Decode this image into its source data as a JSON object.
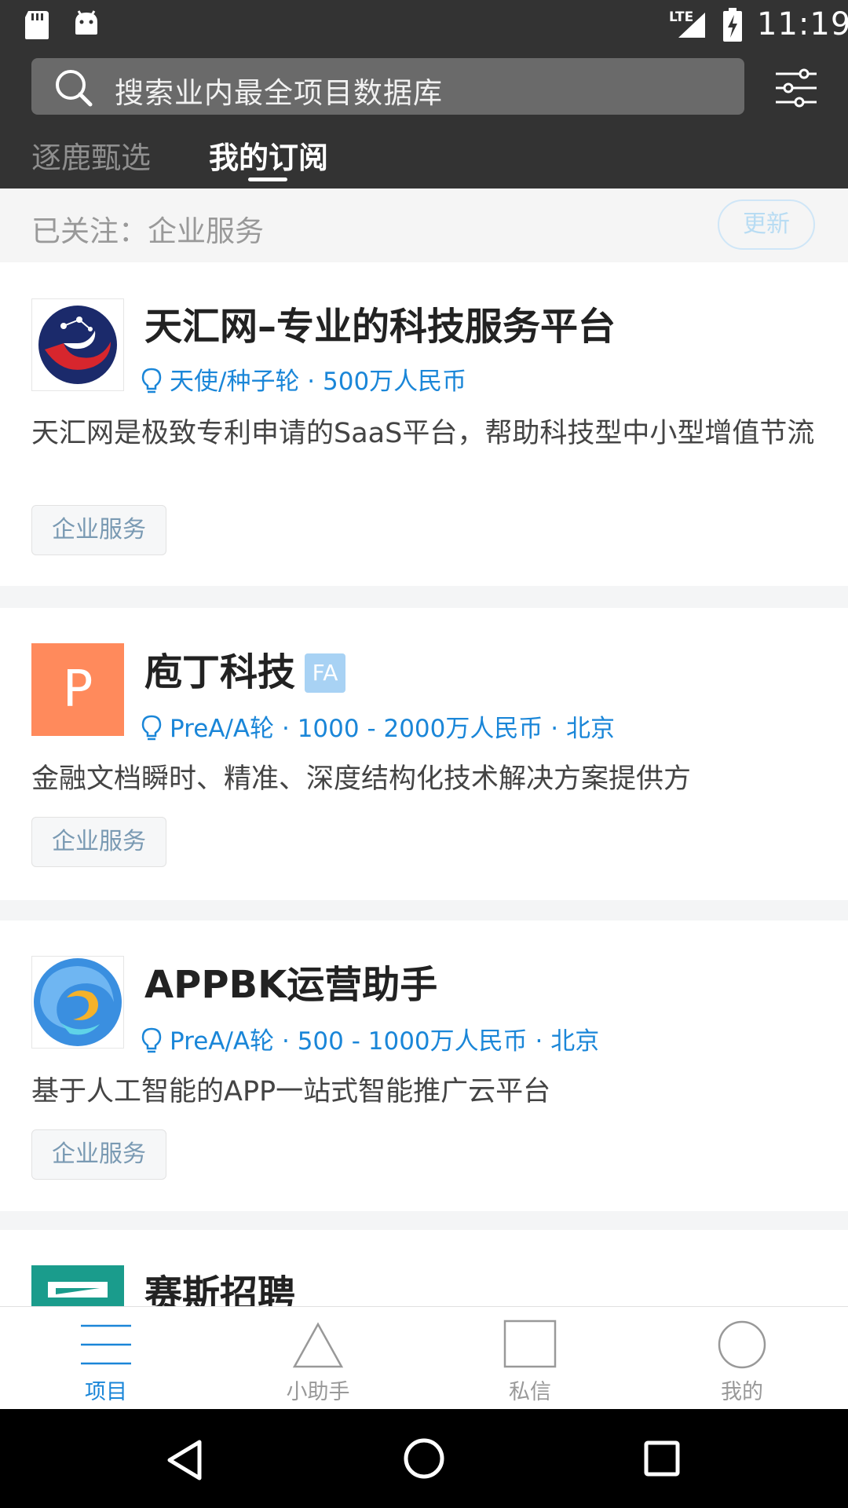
{
  "status_bar": {
    "time": "11:19",
    "network": "LTE"
  },
  "search": {
    "placeholder": "搜索业内最全项目数据库"
  },
  "tabs": [
    {
      "label": "逐鹿甄选",
      "active": false
    },
    {
      "label": "我的订阅",
      "active": true
    }
  ],
  "follow": {
    "label": "已关注：企业服务",
    "refresh_label": "更新"
  },
  "projects": [
    {
      "title": "天汇网–专业的科技服务平台",
      "badge": "",
      "meta": "天使/种子轮 · 500万人民币",
      "description": "天汇网是极致专利申请的SaaS平台，帮助科技型中小型增值节流",
      "tag": "企业服务"
    },
    {
      "title": "庖丁科技",
      "badge": "FA",
      "logo_letter": "P",
      "meta": "PreA/A轮 · 1000 - 2000万人民币 · 北京",
      "description": "金融文档瞬时、精准、深度结构化技术解决方案提供方",
      "tag": "企业服务"
    },
    {
      "title": "APPBK运营助手",
      "badge": "",
      "meta": "PreA/A轮 · 500 - 1000万人民币 · 北京",
      "description": "基于人工智能的APP一站式智能推广云平台",
      "tag": "企业服务"
    },
    {
      "title": "赛斯招聘"
    }
  ],
  "bottom_nav": [
    {
      "label": "项目",
      "icon": "menu-icon",
      "active": true
    },
    {
      "label": "小助手",
      "icon": "triangle-icon",
      "active": false
    },
    {
      "label": "私信",
      "icon": "square-icon",
      "active": false
    },
    {
      "label": "我的",
      "icon": "circle-icon",
      "active": false
    }
  ],
  "colors": {
    "header_bg": "#333333",
    "accent": "#1a86d8",
    "tag_text": "#7a9ab3",
    "logo_orange": "#ff8a5c"
  }
}
